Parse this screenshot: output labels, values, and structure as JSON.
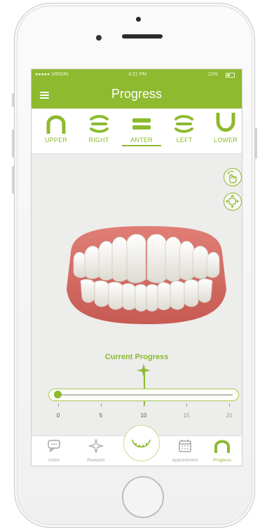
{
  "status_bar": {
    "carrier": "●●●●● VIRGIN",
    "time": "4:21 PM",
    "battery": "22%"
  },
  "header": {
    "title": "Progress"
  },
  "views": [
    {
      "label": "UPPER",
      "icon": "upper-arch-icon"
    },
    {
      "label": "RIGHT",
      "icon": "right-bite-icon"
    },
    {
      "label": "ANTER",
      "icon": "anterior-bite-icon",
      "active": true
    },
    {
      "label": "LEFT",
      "icon": "left-bite-icon"
    },
    {
      "label": "LOWER",
      "icon": "lower-arch-icon"
    }
  ],
  "controls": [
    "rotate-hand-icon",
    "move-arrows-icon"
  ],
  "progress": {
    "label": "Current Progress",
    "current": 10,
    "ticks": [
      "0",
      "5",
      "10",
      "15",
      "20"
    ]
  },
  "tabs": [
    {
      "label": "Inbox",
      "icon": "chat-bubble-icon"
    },
    {
      "label": "Rewards",
      "icon": "sparkle-icon"
    },
    {
      "label": "",
      "icon": "aligner-tray-icon"
    },
    {
      "label": "Appointment",
      "icon": "calendar-icon"
    },
    {
      "label": "Progress",
      "icon": "arch-icon",
      "active": true
    }
  ],
  "colors": {
    "brand": "#8dba2f",
    "screen_bg": "#ededeb",
    "gum": "#d26b63"
  }
}
